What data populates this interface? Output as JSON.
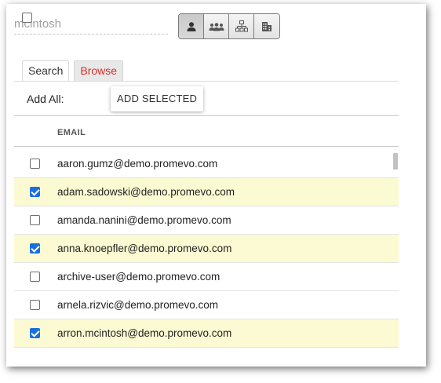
{
  "search": {
    "value": "mcintosh"
  },
  "type_buttons": [
    {
      "icon": "user-icon",
      "active": true
    },
    {
      "icon": "group-icon",
      "active": false
    },
    {
      "icon": "org-chart-icon",
      "active": false
    },
    {
      "icon": "building-icon",
      "active": false
    }
  ],
  "tabs": {
    "search": "Search",
    "browse": "Browse"
  },
  "add_all": {
    "label": "Add All:",
    "checked": false
  },
  "add_selected_label": "ADD SELECTED",
  "table": {
    "column_header": "EMAIL",
    "rows": [
      {
        "email": "aaron.gumz@demo.promevo.com",
        "checked": false
      },
      {
        "email": "adam.sadowski@demo.promevo.com",
        "checked": true
      },
      {
        "email": "amanda.nanini@demo.promevo.com",
        "checked": false
      },
      {
        "email": "anna.knoepfler@demo.promevo.com",
        "checked": true
      },
      {
        "email": "archive-user@demo.promevo.com",
        "checked": false
      },
      {
        "email": "arnela.rizvic@demo.promevo.com",
        "checked": false
      },
      {
        "email": "arron.mcintosh@demo.promevo.com",
        "checked": true
      }
    ]
  },
  "colors": {
    "selected_row": "#fcfad2",
    "browse_tab_text": "#d0312d",
    "checkbox_checked": "#1a6fde"
  }
}
